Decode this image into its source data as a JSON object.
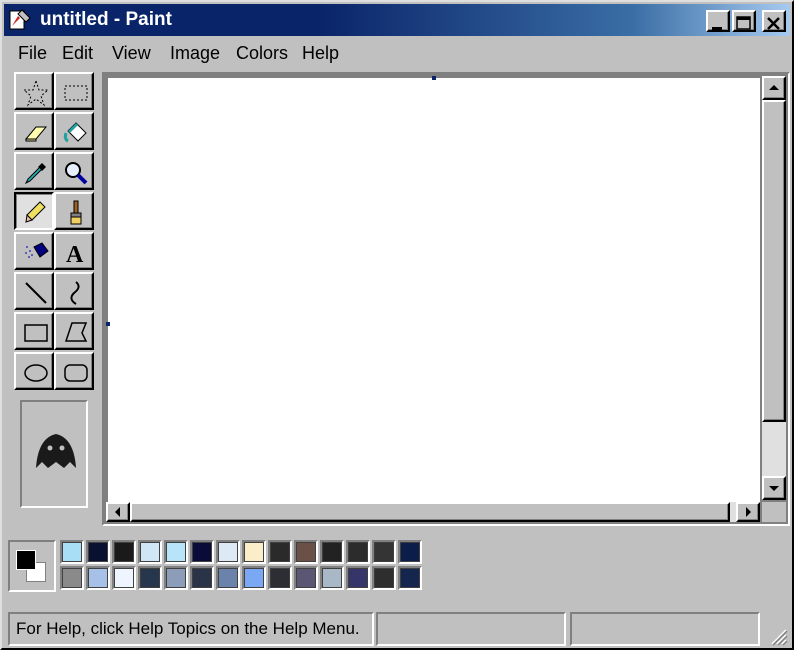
{
  "window": {
    "title": "untitled - Paint"
  },
  "menu": [
    {
      "label": "File"
    },
    {
      "label": "Edit"
    },
    {
      "label": "View"
    },
    {
      "label": "Image"
    },
    {
      "label": "Colors"
    },
    {
      "label": "Help"
    }
  ],
  "tools": [
    {
      "name": "free-form-select",
      "icon": "star-select-icon"
    },
    {
      "name": "select",
      "icon": "rect-select-icon"
    },
    {
      "name": "eraser",
      "icon": "eraser-icon"
    },
    {
      "name": "fill-with-color",
      "icon": "paint-bucket-icon"
    },
    {
      "name": "pick-color",
      "icon": "eyedropper-icon"
    },
    {
      "name": "magnifier",
      "icon": "magnifier-icon"
    },
    {
      "name": "pencil",
      "icon": "pencil-icon",
      "selected": true
    },
    {
      "name": "brush",
      "icon": "brush-icon"
    },
    {
      "name": "airbrush",
      "icon": "airbrush-icon"
    },
    {
      "name": "text",
      "icon": "text-icon"
    },
    {
      "name": "line",
      "icon": "line-icon"
    },
    {
      "name": "curve",
      "icon": "curve-icon"
    },
    {
      "name": "rectangle",
      "icon": "rectangle-icon"
    },
    {
      "name": "polygon",
      "icon": "polygon-icon"
    },
    {
      "name": "ellipse",
      "icon": "ellipse-icon"
    },
    {
      "name": "rounded-rectangle",
      "icon": "rounded-rect-icon"
    }
  ],
  "current_colors": {
    "foreground": "#000000",
    "background": "#ffffff"
  },
  "palette": {
    "row1": [
      "#a9def7",
      "#0a1030",
      "#1a1a1a",
      "#cfe6f6",
      "#b8e4fa",
      "#0b0b3a",
      "#dde9f5",
      "#fbedc8",
      "#2a2a2a",
      "#6a5046",
      "#222222",
      "#2c2c2c",
      "#343434",
      "#0b1e4a"
    ],
    "row2": [
      "#8a8a8a",
      "#a7c0e8",
      "#eef5ff",
      "#26364c",
      "#8d9cb8",
      "#2a3347",
      "#6b83aa",
      "#7aa8f5",
      "#2c2e33",
      "#5a5674",
      "#a8b8c6",
      "#36356a",
      "#2e2e2e",
      "#14264e"
    ]
  },
  "status": {
    "help_text": "For Help, click Help Topics on the Help Menu.",
    "position": "",
    "size": ""
  }
}
